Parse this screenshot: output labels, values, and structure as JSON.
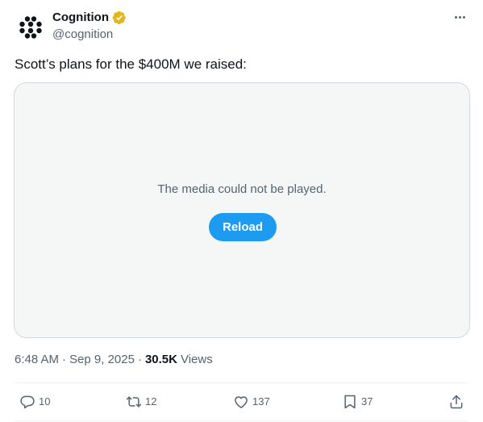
{
  "author": {
    "name": "Cognition",
    "handle": "@cognition",
    "verified_color": "#e2b719"
  },
  "tweet": {
    "text": "Scott’s plans for the $400M we raised:"
  },
  "media": {
    "error_message": "The media could not be played.",
    "reload_label": "Reload"
  },
  "meta": {
    "time": "6:48 AM",
    "separator": "·",
    "date": "Sep 9, 2025",
    "views_count": "30.5K",
    "views_label": "Views"
  },
  "actions": {
    "replies": "10",
    "reposts": "12",
    "likes": "137",
    "bookmarks": "37"
  },
  "colors": {
    "accent": "#1d9bf0",
    "muted_text": "#536471",
    "media_bg": "#f5f7f7"
  }
}
